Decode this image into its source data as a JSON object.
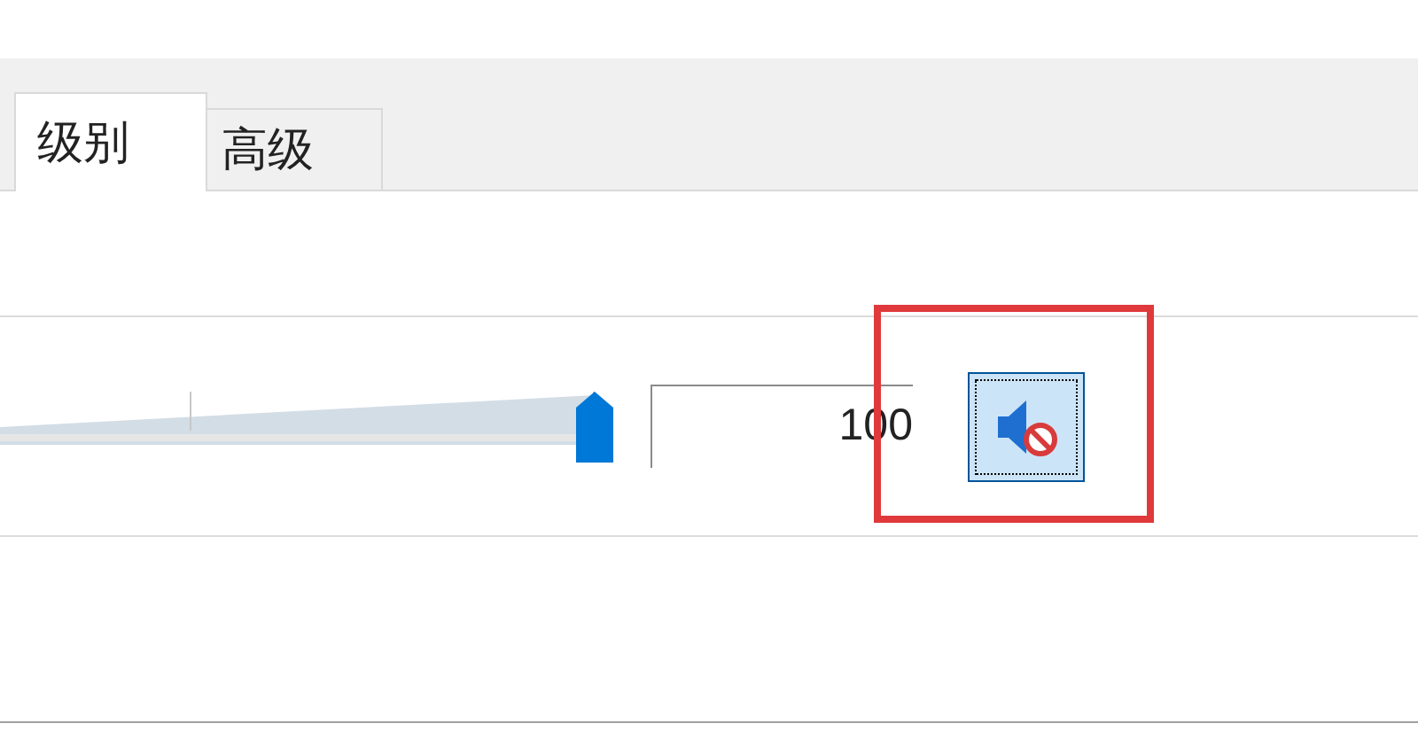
{
  "tabs": [
    {
      "label": "级别",
      "selected": true
    },
    {
      "label": "高级",
      "selected": false
    }
  ],
  "volume": {
    "level": 1,
    "value": "100",
    "muted": true,
    "mute_button_highlighted": true
  }
}
